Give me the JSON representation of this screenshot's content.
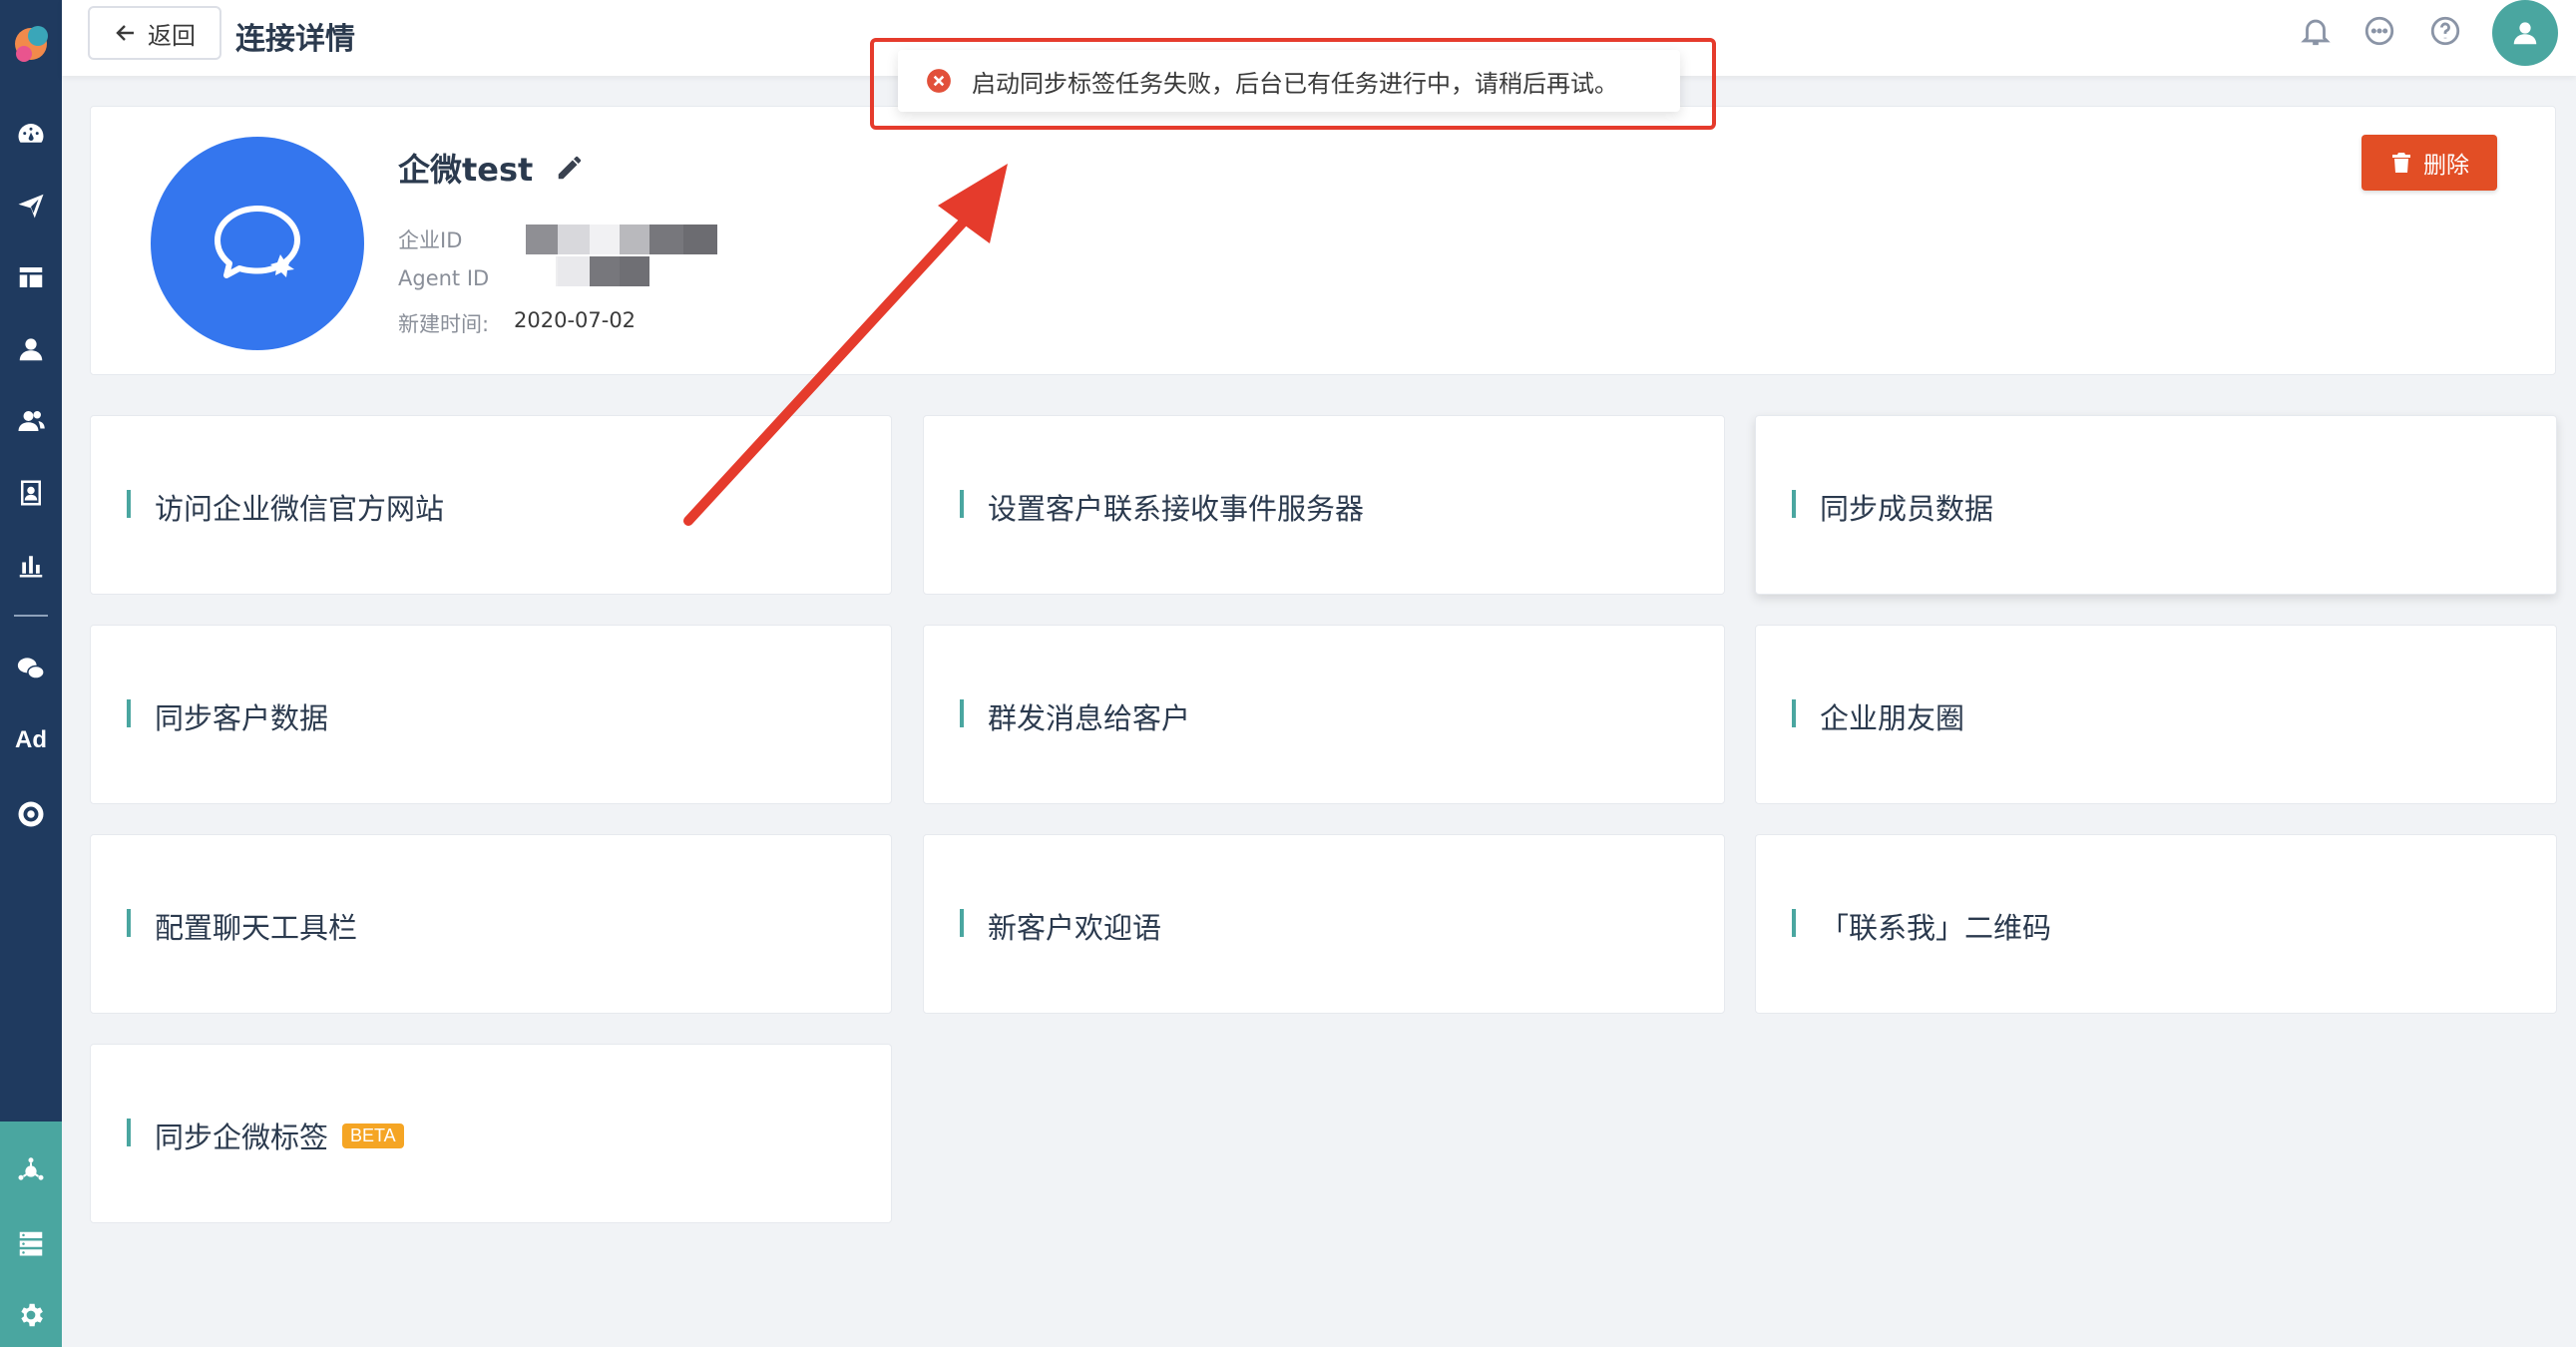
{
  "header": {
    "back_label": "返回",
    "title": "连接详情"
  },
  "profile": {
    "name": "企微test",
    "corp_id_label": "企业ID",
    "agent_id_label": "Agent ID",
    "created_label": "新建时间:",
    "created_value": "2020-07-02",
    "delete_label": "删除"
  },
  "toast": {
    "message": "启动同步标签任务失败，后台已有任务进行中，请稍后再试。"
  },
  "features": [
    {
      "label": "访问企业微信官方网站"
    },
    {
      "label": "设置客户联系接收事件服务器"
    },
    {
      "label": "同步成员数据"
    },
    {
      "label": "同步客户数据"
    },
    {
      "label": "群发消息给客户"
    },
    {
      "label": "企业朋友圈"
    },
    {
      "label": "配置聊天工具栏"
    },
    {
      "label": "新客户欢迎语"
    },
    {
      "label": "「联系我」二维码"
    },
    {
      "label": "同步企微标签",
      "badge": "BETA"
    }
  ],
  "sidebar": {
    "items": [
      {
        "icon": "dashboard-icon"
      },
      {
        "icon": "send-icon"
      },
      {
        "icon": "layout-icon"
      },
      {
        "icon": "user-icon"
      },
      {
        "icon": "users-icon"
      },
      {
        "icon": "contact-card-icon"
      },
      {
        "icon": "bar-chart-icon"
      },
      {
        "icon": "wechat-icon"
      },
      {
        "text": "Ad"
      },
      {
        "icon": "target-icon"
      },
      {
        "icon": "integrations-icon"
      },
      {
        "icon": "server-icon"
      },
      {
        "icon": "settings-icon"
      }
    ]
  },
  "colors": {
    "sidebar": "#1f3a5f",
    "accent": "#4aa6a0",
    "danger": "#e24e25",
    "wechat_blue": "#3476ee",
    "beta": "#f5a524"
  }
}
